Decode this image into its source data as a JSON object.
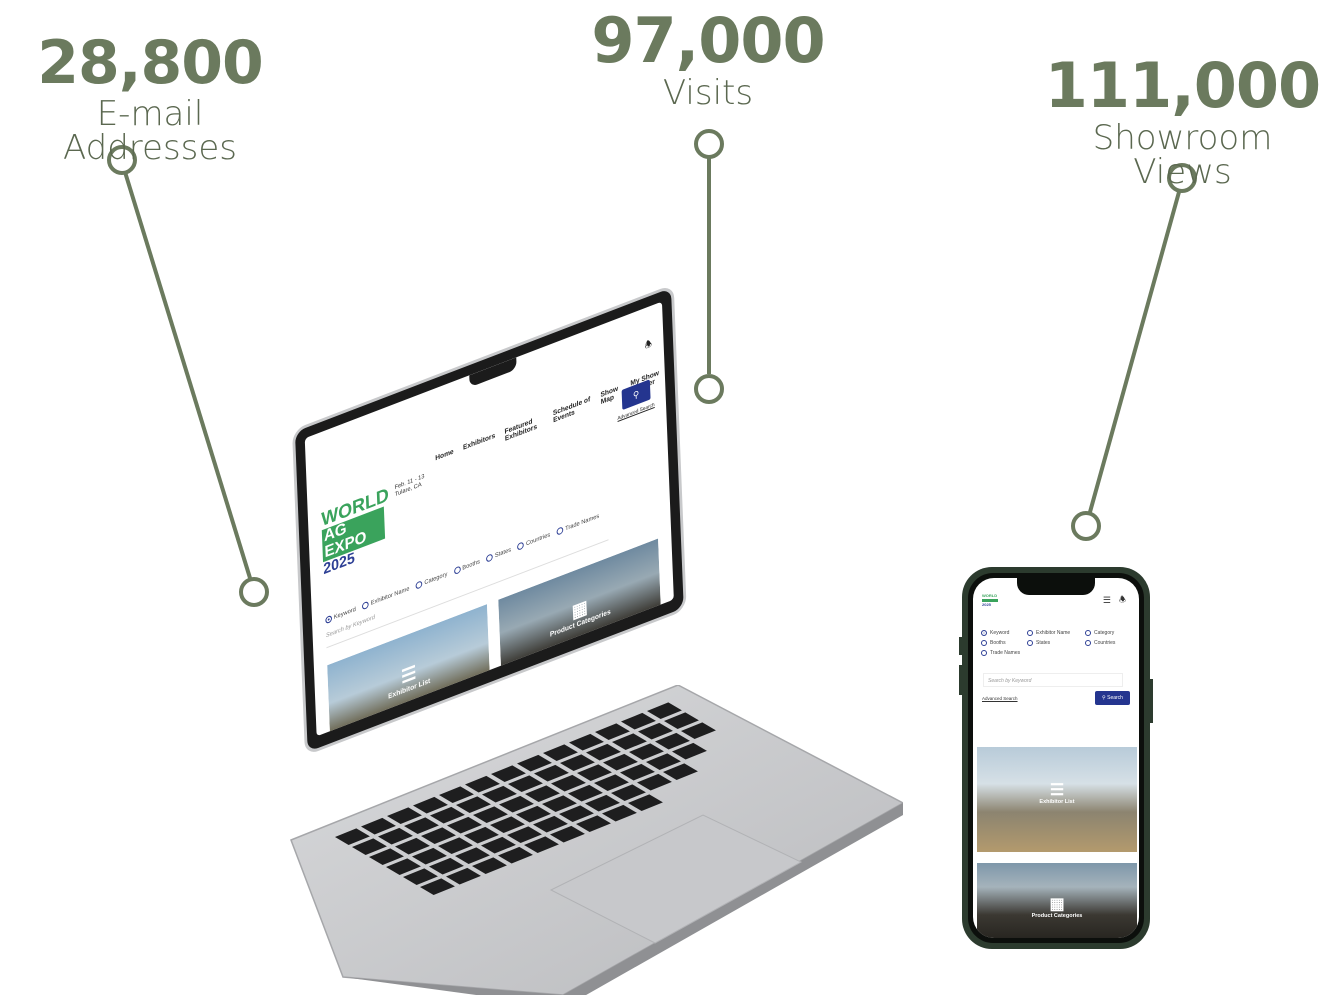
{
  "stats": [
    {
      "value": "28,800",
      "label": "E-mail Addresses"
    },
    {
      "value": "97,000",
      "label": "Visits"
    },
    {
      "value": "111,000",
      "label": "Showroom Views"
    }
  ],
  "colors": {
    "accent": "#6b7a5e",
    "brand_green": "#3aa35c",
    "brand_blue": "#24358f"
  },
  "site": {
    "logo_world": "WORLD",
    "logo_agexpo": "AG EXPO",
    "logo_year": "2025",
    "dates": "Feb. 11 - 13 Tulare, CA",
    "nav": [
      "Home",
      "Exhibitors",
      "Featured Exhibitors",
      "Schedule of Events",
      "Show Map",
      "My Show Planner"
    ],
    "radio_options": [
      "Keyword",
      "Exhibitor Name",
      "Category",
      "Booths",
      "States",
      "Countries",
      "Trade Names"
    ],
    "search_placeholder": "Search by Keyword",
    "advanced_search": "Advanced Search",
    "search_button": "Search",
    "tiles": [
      "Exhibitor List",
      "Product Categories"
    ]
  },
  "icons": [
    "search-icon",
    "bell-icon",
    "menu-icon",
    "list-icon",
    "grid-icon"
  ]
}
